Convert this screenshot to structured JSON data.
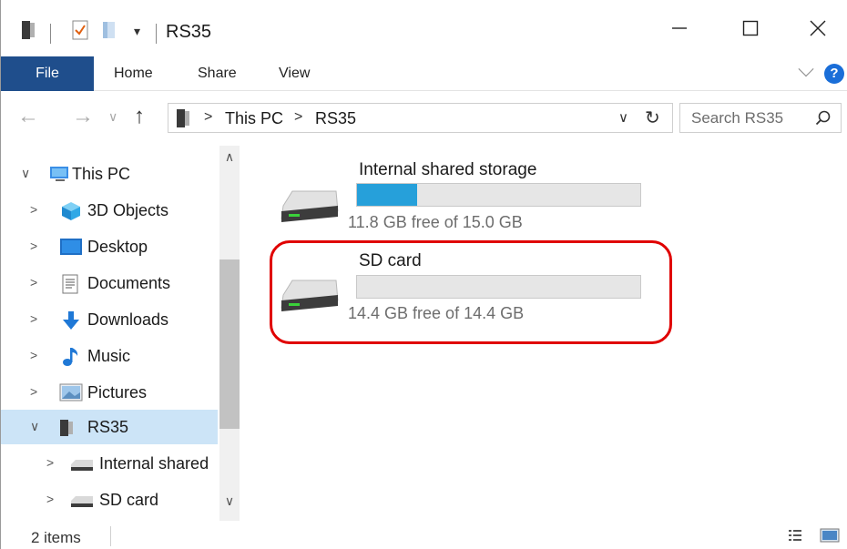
{
  "window": {
    "title": "RS35"
  },
  "ribbon": {
    "tabs": [
      {
        "label": "File"
      },
      {
        "label": "Home"
      },
      {
        "label": "Share"
      },
      {
        "label": "View"
      }
    ],
    "help_label": "?"
  },
  "address": {
    "crumbs": [
      "This PC",
      "RS35"
    ]
  },
  "search": {
    "placeholder": "Search RS35"
  },
  "nav_pane": {
    "items": [
      {
        "label": "This PC",
        "icon": "computer-icon",
        "expanded": true
      },
      {
        "label": "3D Objects",
        "icon": "3d-objects-icon"
      },
      {
        "label": "Desktop",
        "icon": "desktop-icon"
      },
      {
        "label": "Documents",
        "icon": "documents-icon"
      },
      {
        "label": "Downloads",
        "icon": "downloads-icon"
      },
      {
        "label": "Music",
        "icon": "music-icon"
      },
      {
        "label": "Pictures",
        "icon": "pictures-icon"
      },
      {
        "label": "RS35",
        "icon": "device-icon",
        "expanded": true,
        "selected": true
      },
      {
        "label": "Internal shared",
        "icon": "drive-icon"
      },
      {
        "label": "SD card",
        "icon": "drive-icon"
      }
    ]
  },
  "drives": [
    {
      "name": "Internal shared storage",
      "free_text": "11.8 GB free of 15.0 GB",
      "used_fraction": 0.213
    },
    {
      "name": "SD card",
      "free_text": "14.4 GB free of 14.4 GB",
      "used_fraction": 0.0
    }
  ],
  "status": {
    "item_count": "2 items"
  },
  "colors": {
    "file_tab": "#1f4e8c",
    "usage_bar": "#26a0da",
    "selection": "#cce4f7",
    "highlight": "#e00000"
  }
}
